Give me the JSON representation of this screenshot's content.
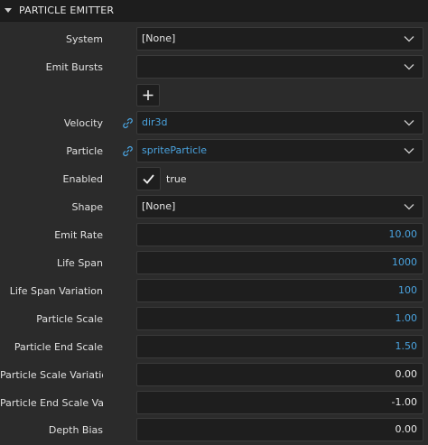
{
  "panel": {
    "title": "PARTICLE EMITTER"
  },
  "fields": {
    "system": {
      "label": "System",
      "value": "[None]"
    },
    "emit_bursts": {
      "label": "Emit Bursts",
      "value": ""
    },
    "add_label": "+",
    "velocity": {
      "label": "Velocity",
      "value": "dir3d"
    },
    "particle": {
      "label": "Particle",
      "value": "spriteParticle"
    },
    "enabled": {
      "label": "Enabled",
      "value": "true"
    },
    "shape": {
      "label": "Shape",
      "value": "[None]"
    },
    "emit_rate": {
      "label": "Emit Rate",
      "value": "10.00"
    },
    "life_span": {
      "label": "Life Span",
      "value": "1000"
    },
    "life_span_variation": {
      "label": "Life Span Variation",
      "value": "100"
    },
    "particle_scale": {
      "label": "Particle Scale",
      "value": "1.00"
    },
    "particle_end_scale": {
      "label": "Particle End Scale",
      "value": "1.50"
    },
    "particle_scale_variation": {
      "label": "Particle Scale Variation",
      "value": "0.00"
    },
    "particle_end_scale_variation": {
      "label": "Particle End Scale Va...",
      "value": "-1.00"
    },
    "depth_bias": {
      "label": "Depth Bias",
      "value": "0.00"
    }
  },
  "icons": {
    "link": "link-icon",
    "chevron": "chevron-down-icon",
    "check": "checkmark-icon",
    "collapse": "caret-down-icon"
  },
  "colors": {
    "accent_blue": "#4aa3df",
    "background": "#2b2b2b",
    "field_bg": "#1e1e1e",
    "header_bg": "#1d1d1d"
  }
}
